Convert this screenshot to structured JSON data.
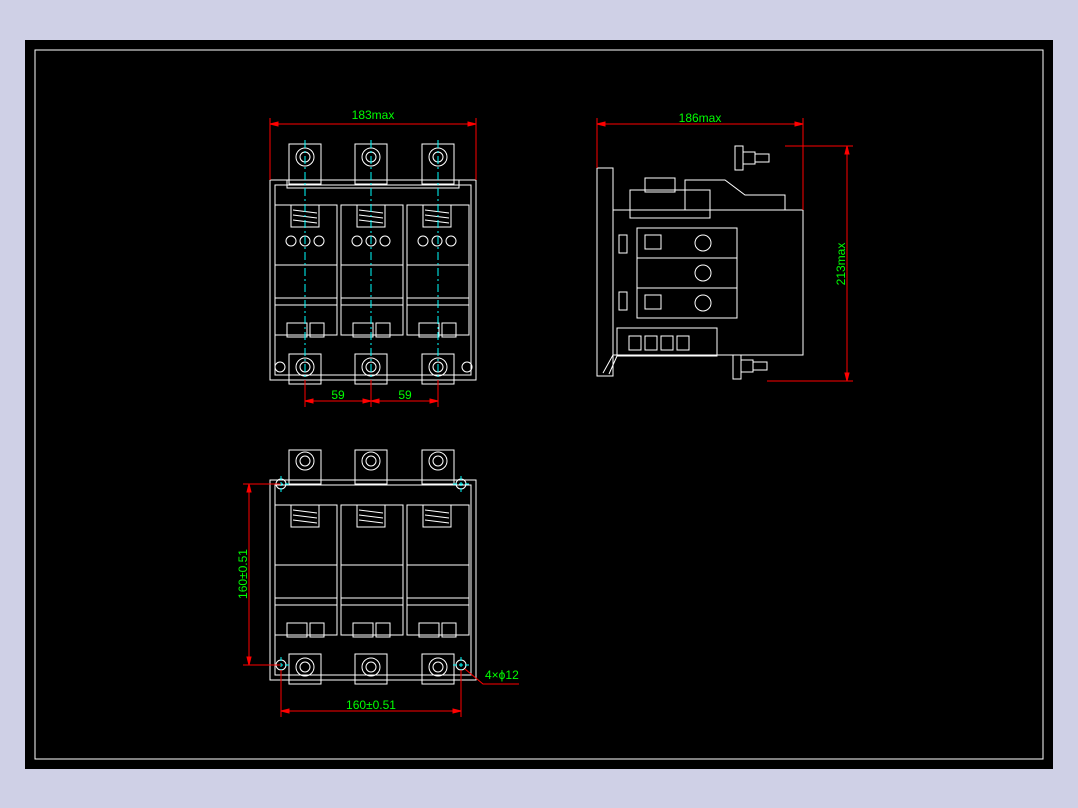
{
  "drawing": {
    "colors": {
      "background": "#cfd0e6",
      "sheet": "#000000",
      "linework": "#ffffff",
      "dimension_line": "#ff0000",
      "dimension_text": "#00ff00",
      "centerline": "#00ffff"
    },
    "dimensions": {
      "front_width": "183max",
      "pitch_left": "59",
      "pitch_right": "59",
      "side_width": "186max",
      "side_height": "213max",
      "mount_height": "160±0.51",
      "mount_width": "160±0.51",
      "hole_note": "4×ϕ12"
    }
  }
}
